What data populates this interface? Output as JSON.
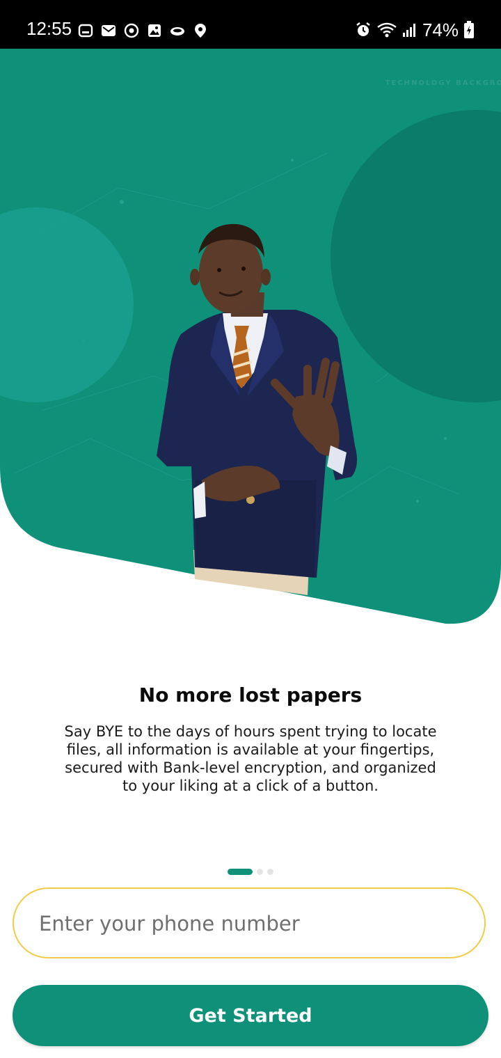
{
  "status_bar": {
    "time": "12:55",
    "battery": "74%",
    "left_icons": [
      "notification-icon",
      "mail-icon",
      "sync-icon",
      "gallery-icon",
      "cloud-icon",
      "location-icon"
    ],
    "right_icons": [
      "alarm-icon",
      "wifi-icon",
      "signal-icon",
      "battery-icon"
    ]
  },
  "hero": {
    "watermark": "TECHNOLOGY BACKGRO",
    "colors": {
      "primary": "#0e9079",
      "dark_circle": "#0a7c69",
      "light_circle": "#1aa090"
    }
  },
  "onboarding": {
    "title": "No more lost papers",
    "description": "Say BYE to the days of hours spent trying to locate files, all information is available at your fingertips, secured with Bank-level encryption, and organized to your liking at a click of a button.",
    "page_index": 0,
    "page_count": 3
  },
  "phone_input": {
    "placeholder": "Enter your phone number",
    "value": ""
  },
  "cta": {
    "label": "Get Started"
  }
}
